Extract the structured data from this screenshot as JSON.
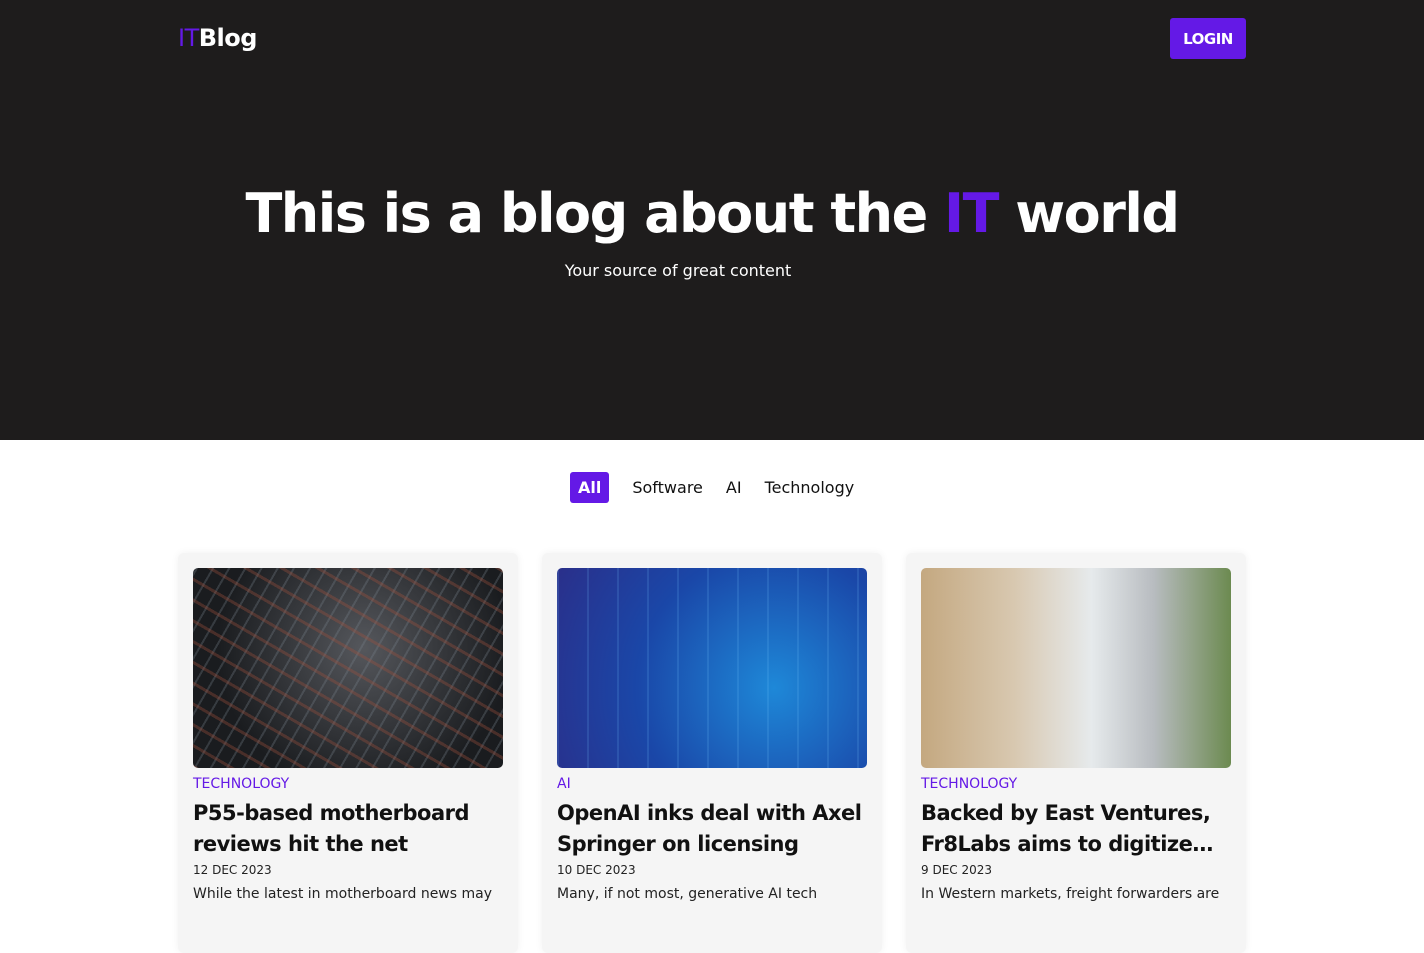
{
  "header": {
    "logo_it": "IT",
    "logo_blog": "Blog",
    "login_label": "LOGIN"
  },
  "hero": {
    "title_pre": "This is a blog about the ",
    "title_accent": "IT",
    "title_post": " world",
    "subtitle": "Your source of great content"
  },
  "filters": [
    {
      "label": "All",
      "active": true
    },
    {
      "label": "Software"
    },
    {
      "label": "AI"
    },
    {
      "label": "Technology"
    }
  ],
  "colors": {
    "accent": "#6419e6",
    "hero_bg": "#1e1c1c"
  },
  "posts": [
    {
      "category": "TECHNOLOGY",
      "title": "P55-based motherboard reviews hit the net",
      "date": "12 DEC 2023",
      "excerpt": "While the latest in motherboard news may"
    },
    {
      "category": "AI",
      "title": "OpenAI inks deal with Axel Springer on licensing news…",
      "date": "10 DEC 2023",
      "excerpt": "Many, if not most, generative AI tech"
    },
    {
      "category": "TECHNOLOGY",
      "title": "Backed by East Ventures, Fr8Labs aims to digitize…",
      "date": "9 DEC 2023",
      "excerpt": "In Western markets, freight forwarders are"
    }
  ]
}
